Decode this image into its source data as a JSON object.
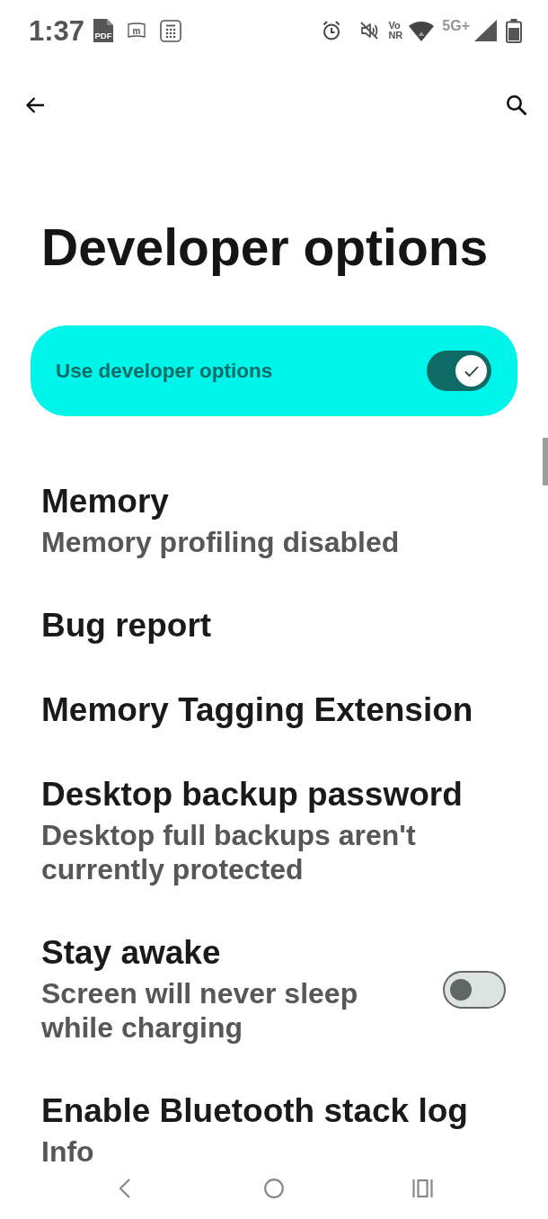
{
  "status_bar": {
    "time": "1:37",
    "notification_icons": [
      {
        "kind": "pdf",
        "label": "PDF"
      },
      {
        "kind": "app",
        "label": "m"
      },
      {
        "kind": "calculator"
      }
    ],
    "voice_badge": {
      "top": "Vo",
      "bottom": "NR"
    },
    "network_type": "5G+"
  },
  "title": "Developer options",
  "main_switch": {
    "label": "Use developer options",
    "on": true
  },
  "settings": [
    {
      "kind": "plain",
      "title": "Memory",
      "subtitle": "Memory profiling disabled"
    },
    {
      "kind": "plain",
      "title": "Bug report"
    },
    {
      "kind": "plain",
      "title": "Memory Tagging Extension"
    },
    {
      "kind": "plain",
      "title": "Desktop backup password",
      "subtitle": "Desktop full backups aren't currently protected"
    },
    {
      "kind": "switch",
      "title": "Stay awake",
      "subtitle": "Screen will never sleep while charging",
      "on": false
    },
    {
      "kind": "plain",
      "title": "Enable Bluetooth stack log",
      "subtitle": "Info"
    }
  ]
}
